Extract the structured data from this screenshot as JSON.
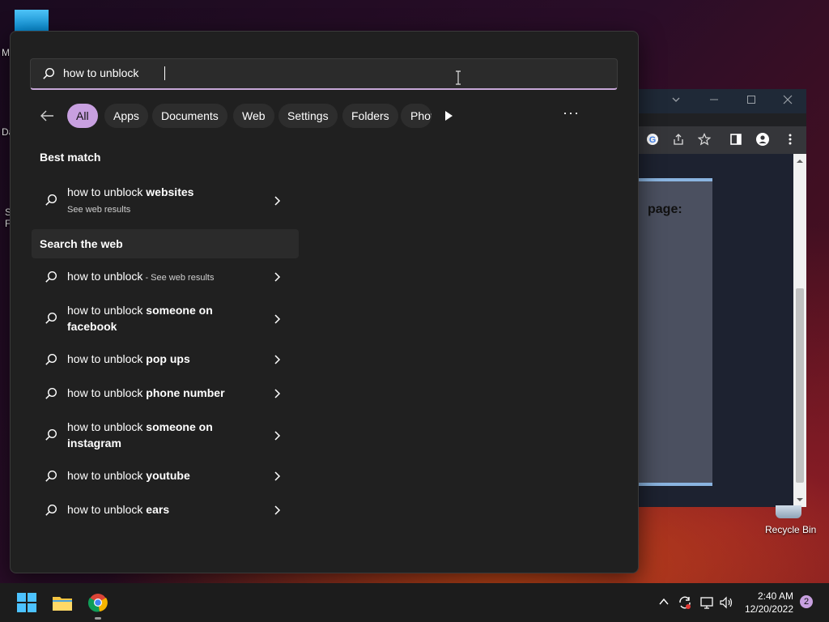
{
  "desktop": {
    "left_labels": [
      "M",
      "Da",
      "S",
      "F"
    ],
    "recycle_bin_label": "Recycle Bin"
  },
  "browser": {
    "page_text": "page:"
  },
  "search": {
    "query": "how to unblock ",
    "filters": [
      "All",
      "Apps",
      "Documents",
      "Web",
      "Settings",
      "Folders",
      "Phot"
    ],
    "best_match_title": "Best match",
    "best_match": {
      "prefix": "how to unblock ",
      "bold": "websites",
      "subtitle": "See web results"
    },
    "web_section_title": "Search the web",
    "web_first": {
      "prefix": "how to unblock",
      "suffix": " - See web results"
    },
    "results": [
      {
        "prefix": "how to unblock ",
        "bold": "someone on facebook"
      },
      {
        "prefix": "how to unblock ",
        "bold": "pop ups"
      },
      {
        "prefix": "how to unblock ",
        "bold": "phone number"
      },
      {
        "prefix": "how to unblock ",
        "bold": "someone on instagram"
      },
      {
        "prefix": "how to unblock ",
        "bold": "youtube"
      },
      {
        "prefix": "how to unblock ",
        "bold": "ears"
      }
    ]
  },
  "taskbar": {
    "time": "2:40 AM",
    "date": "12/20/2022",
    "notification_count": "2"
  },
  "colors": {
    "accent": "#c8a0e0",
    "panel_bg": "#202020",
    "taskbar_bg": "#1c1c1c"
  }
}
